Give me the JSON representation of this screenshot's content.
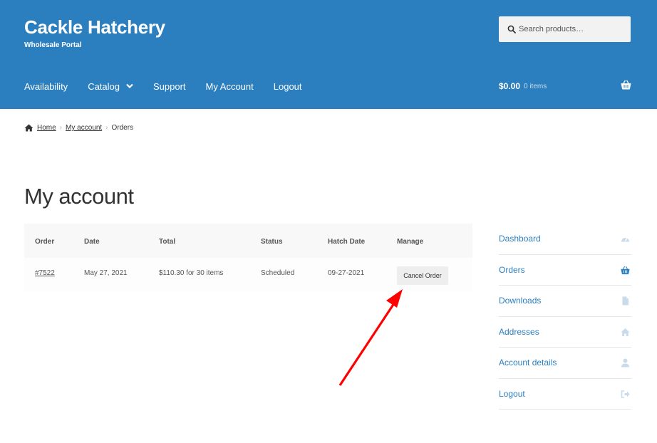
{
  "header": {
    "site_title": "Cackle Hatchery",
    "tagline": "Wholesale Portal",
    "search_placeholder": "Search products…",
    "nav": [
      {
        "label": "Availability"
      },
      {
        "label": "Catalog"
      },
      {
        "label": "Support"
      },
      {
        "label": "My Account"
      },
      {
        "label": "Logout"
      }
    ],
    "cart": {
      "amount": "$0.00",
      "count": "0 items"
    }
  },
  "breadcrumb": {
    "home": "Home",
    "account": "My account",
    "current": "Orders"
  },
  "page_title": "My account",
  "orders": {
    "headers": {
      "order": "Order",
      "date": "Date",
      "total": "Total",
      "status": "Status",
      "hatch_date": "Hatch Date",
      "manage": "Manage"
    },
    "rows": [
      {
        "order": "#7522",
        "date": "May 27, 2021",
        "total": "$110.30 for 30 items",
        "status": "Scheduled",
        "hatch_date": "09-27-2021",
        "action": "Cancel Order"
      }
    ]
  },
  "account_nav": [
    {
      "label": "Dashboard",
      "icon": "dashboard-icon"
    },
    {
      "label": "Orders",
      "icon": "basket-icon"
    },
    {
      "label": "Downloads",
      "icon": "file-icon"
    },
    {
      "label": "Addresses",
      "icon": "home-icon"
    },
    {
      "label": "Account details",
      "icon": "user-icon"
    },
    {
      "label": "Logout",
      "icon": "sign-out-icon"
    }
  ],
  "colors": {
    "brand": "#2c7fbf",
    "arrow": "#ff0000"
  }
}
